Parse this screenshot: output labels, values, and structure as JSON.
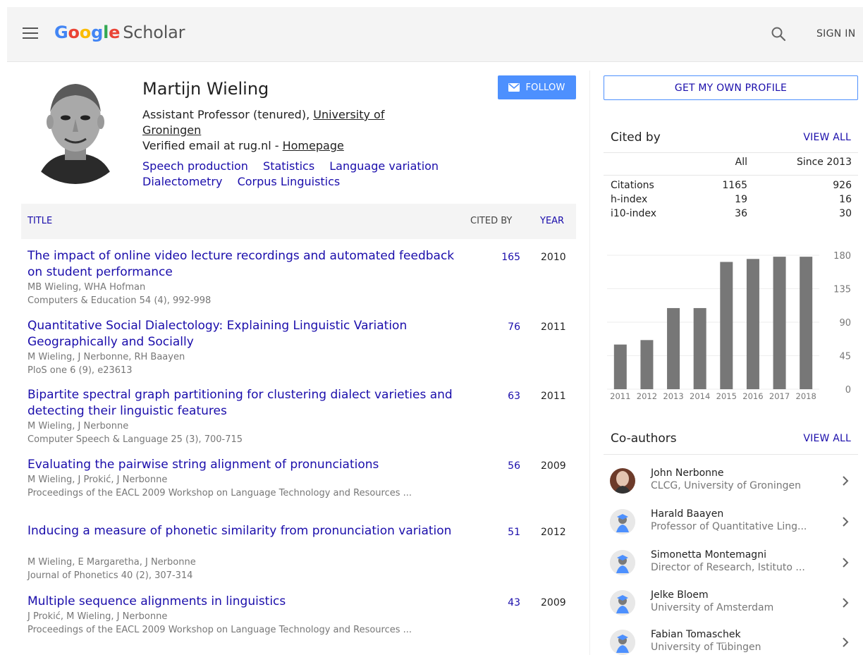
{
  "header": {
    "logo_google": [
      "G",
      "o",
      "o",
      "g",
      "l",
      "e"
    ],
    "logo_colors": [
      "#4285f4",
      "#ea4335",
      "#fbbc05",
      "#4285f4",
      "#34a853",
      "#ea4335"
    ],
    "logo_scholar": "Scholar",
    "sign_in": "SIGN IN",
    "icons": [
      "menu-icon",
      "search-icon"
    ]
  },
  "profile": {
    "name": "Martijn Wieling",
    "affiliation_prefix": "Assistant Professor (tenured), ",
    "affiliation_link": "University of Groningen",
    "email_text": "Verified email at rug.nl - ",
    "homepage": "Homepage",
    "interests": [
      "Speech production",
      "Statistics",
      "Language variation",
      "Dialectometry",
      "Corpus Linguistics"
    ],
    "follow": "FOLLOW",
    "accent": "#4d90fe"
  },
  "table": {
    "col_title": "TITLE",
    "col_cited": "CITED BY",
    "col_year": "YEAR",
    "rows": [
      {
        "title": "The impact of online video lecture recordings and automated feedback on student performance",
        "authors": "MB Wieling, WHA Hofman",
        "venue": "Computers & Education 54 (4), 992-998",
        "cited": "165",
        "year": "2010"
      },
      {
        "title": "Quantitative Social Dialectology: Explaining Linguistic Variation Geographically and Socially",
        "authors": "M Wieling, J Nerbonne, RH Baayen",
        "venue": "PloS one 6 (9), e23613",
        "cited": "76",
        "year": "2011"
      },
      {
        "title": "Bipartite spectral graph partitioning for clustering dialect varieties and detecting their linguistic features",
        "authors": "M Wieling, J Nerbonne",
        "venue": "Computer Speech & Language 25 (3), 700-715",
        "cited": "63",
        "year": "2011"
      },
      {
        "title": "Evaluating the pairwise string alignment of pronunciations",
        "authors": "M Wieling, J Prokić, J Nerbonne",
        "venue": "Proceedings of the EACL 2009 Workshop on Language Technology and Resources ...",
        "cited": "56",
        "year": "2009"
      },
      {
        "title": "Inducing a measure of phonetic similarity from pronunciation variation",
        "authors": "M Wieling, E Margaretha, J Nerbonne",
        "venue": "Journal of Phonetics 40 (2), 307-314",
        "cited": "51",
        "year": "2012"
      },
      {
        "title": "Multiple sequence alignments in linguistics",
        "authors": "J Prokić, M Wieling, J Nerbonne",
        "venue": "Proceedings of the EACL 2009 Workshop on Language Technology and Resources ...",
        "cited": "43",
        "year": "2009"
      }
    ]
  },
  "sidebar": {
    "own_profile": "GET MY OWN PROFILE",
    "cited_by_title": "Cited by",
    "view_all": "VIEW ALL",
    "col_all": "All",
    "col_since": "Since 2013",
    "metrics": [
      {
        "label": "Citations",
        "all": "1165",
        "since": "926"
      },
      {
        "label": "h-index",
        "all": "19",
        "since": "16"
      },
      {
        "label": "i10-index",
        "all": "36",
        "since": "30"
      }
    ],
    "coauthors_title": "Co-authors",
    "coauthors_view_all": "VIEW ALL",
    "coauthors": [
      {
        "name": "John Nerbonne",
        "affiliation": "CLCG, University of Groningen",
        "photo": true
      },
      {
        "name": "Harald Baayen",
        "affiliation": "Professor of Quantitative Ling...",
        "photo": false
      },
      {
        "name": "Simonetta Montemagni",
        "affiliation": "Director of Research, Istituto ...",
        "photo": false
      },
      {
        "name": "Jelke Bloem",
        "affiliation": "University of Amsterdam",
        "photo": false
      },
      {
        "name": "Fabian Tomaschek",
        "affiliation": "University of Tübingen",
        "photo": false
      }
    ]
  },
  "chart_data": {
    "type": "bar",
    "categories": [
      "2011",
      "2012",
      "2013",
      "2014",
      "2015",
      "2016",
      "2017",
      "2018"
    ],
    "values": [
      60,
      66,
      109,
      109,
      171,
      175,
      178,
      178
    ],
    "ylim": [
      0,
      180
    ],
    "yticks": [
      "180",
      "135",
      "90",
      "45",
      "0"
    ],
    "ytick_values": [
      180,
      135,
      90,
      45,
      0
    ],
    "grid": true,
    "bar_color": "#777777"
  }
}
